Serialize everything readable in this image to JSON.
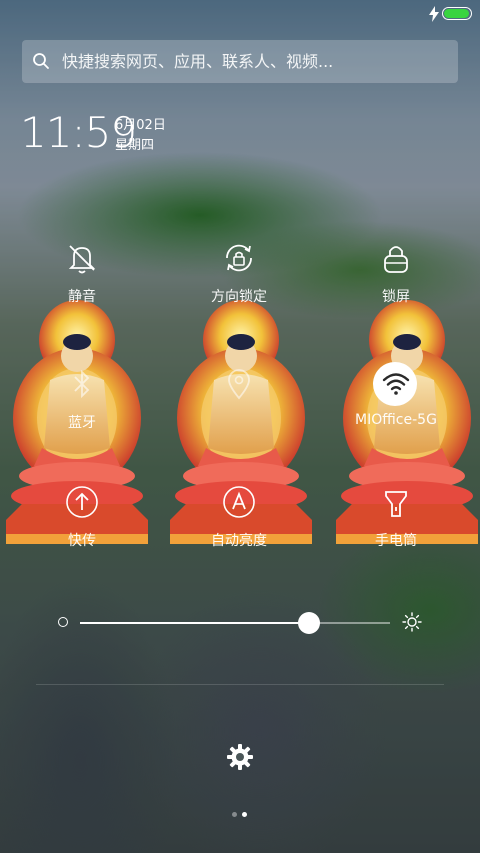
{
  "status_bar": {
    "battery_level": 0.95,
    "charging": true,
    "battery_color": "#39d440"
  },
  "search": {
    "placeholder": "快捷搜索网页、应用、联系人、视频..."
  },
  "clock": {
    "time": "11:59",
    "date": "6月02日",
    "weekday": "星期四"
  },
  "toggles": [
    {
      "id": "mute",
      "label": "静音",
      "icon": "bell-off-icon",
      "active": false
    },
    {
      "id": "rotation-lock",
      "label": "方向锁定",
      "icon": "rotation-lock-icon",
      "active": false
    },
    {
      "id": "lock-screen",
      "label": "锁屏",
      "icon": "lock-icon",
      "active": false
    },
    {
      "id": "bluetooth",
      "label": "蓝牙",
      "icon": "bluetooth-icon",
      "active": false
    },
    {
      "id": "gps",
      "label": "",
      "icon": "location-icon",
      "active": false
    },
    {
      "id": "wifi",
      "label": "MIOffice-5G",
      "icon": "wifi-icon",
      "active": true
    },
    {
      "id": "data",
      "label": "快传",
      "icon": "transfer-icon",
      "active": false
    },
    {
      "id": "auto-brightness",
      "label": "自动亮度",
      "icon": "auto-brightness-icon",
      "active": false
    },
    {
      "id": "flashlight",
      "label": "手电筒",
      "icon": "flashlight-icon",
      "active": false
    }
  ],
  "brightness": {
    "value": 0.74
  },
  "pager": {
    "pages": 2,
    "current": 2
  },
  "colors": {
    "accent": "#39d440",
    "toggle_active_bg": "#ffffff"
  }
}
